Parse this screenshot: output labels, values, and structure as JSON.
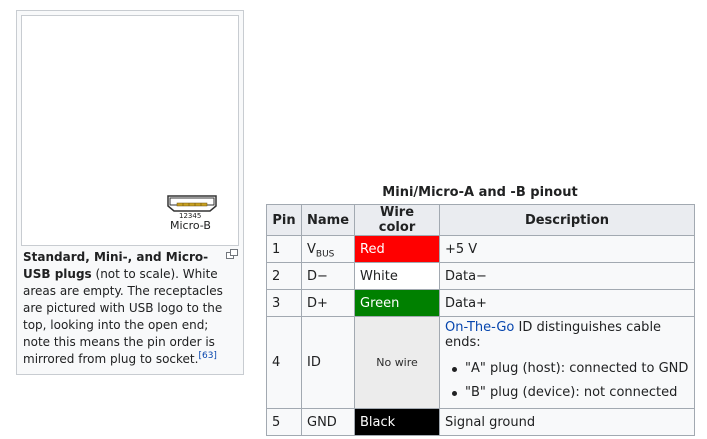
{
  "figure": {
    "plug_label": "Micro-B",
    "pin_numbers": "12345",
    "caption_bold": "Standard, Mini-, and Micro-USB plugs",
    "caption_rest": " (not to scale). White areas are empty. The receptacles are pictured with USB logo to the top, looking into the open end; note this means the pin order is mirrored from plug to socket.",
    "citation": "[63]"
  },
  "table": {
    "title": "Mini/Micro-A and -B pinout",
    "headers": {
      "pin": "Pin",
      "name": "Name",
      "wire_color": "Wire color",
      "description": "Description"
    },
    "rows": [
      {
        "pin": "1",
        "name_main": "V",
        "name_sub": "BUS",
        "wire": "Red",
        "description": "+5 V"
      },
      {
        "pin": "2",
        "name": "D−",
        "wire": "White",
        "description": "Data−"
      },
      {
        "pin": "3",
        "name": "D+",
        "wire": "Green",
        "description": "Data+"
      },
      {
        "pin": "4",
        "name": "ID",
        "wire": "No wire",
        "description_link": "On-The-Go",
        "description_rest": " ID distinguishes cable ends:",
        "bullets": [
          "\"A\" plug (host): connected to GND",
          "\"B\" plug (device): not connected"
        ]
      },
      {
        "pin": "5",
        "name": "GND",
        "wire": "Black",
        "description": "Signal ground"
      }
    ]
  },
  "colors": {
    "red": "#ff0000",
    "green": "#008000",
    "black": "#000000",
    "link": "#0645ad"
  }
}
